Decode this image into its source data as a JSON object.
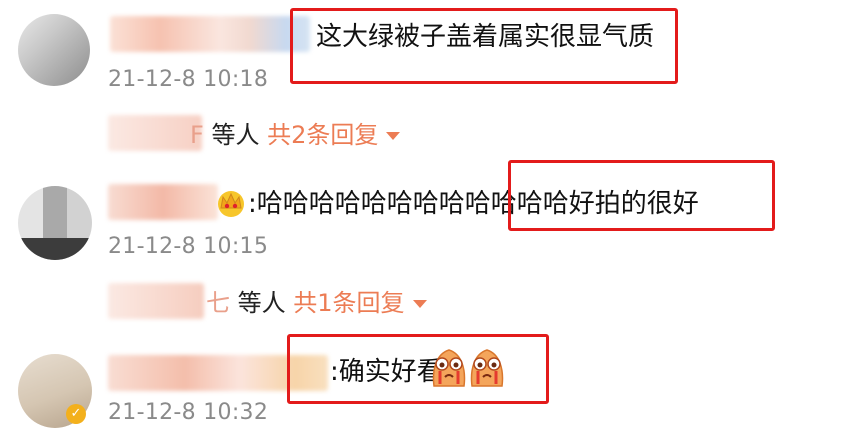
{
  "comments": [
    {
      "text": "这大绿被子盖着属实很显气质",
      "timestamp": "21-12-8 10:18",
      "reply_summary": {
        "name_tail": "F",
        "mid": " 等人 ",
        "count": "共2条回复"
      }
    },
    {
      "text": ":哈哈哈哈哈哈哈哈哈哈哈哈好拍的很好",
      "timestamp": "21-12-8 10:15",
      "badge": "crown-icon",
      "reply_summary": {
        "name_tail": "七",
        "mid": " 等人 ",
        "count": "共1条回复"
      }
    },
    {
      "text": ":确实好看",
      "timestamp": "21-12-8 10:32",
      "emojis": [
        "crying-emoji",
        "crying-emoji"
      ]
    }
  ],
  "colors": {
    "highlight": "#e31b1b",
    "reply_count": "#ec7c54",
    "timestamp": "#8a8a8a"
  }
}
